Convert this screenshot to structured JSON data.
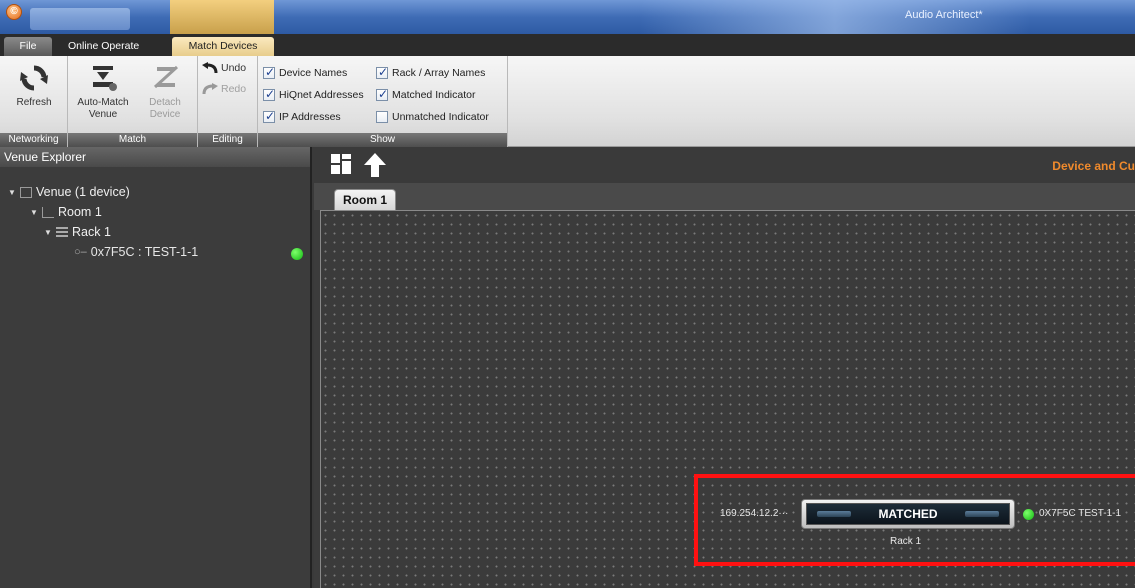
{
  "window": {
    "title": "Audio Architect*",
    "app_button_glyph": "©"
  },
  "tabs": [
    {
      "label": "File"
    },
    {
      "label": "Online Operate"
    },
    {
      "label": "Match Devices"
    }
  ],
  "ribbon": {
    "networking": {
      "label": "Networking",
      "refresh": "Refresh"
    },
    "match": {
      "label": "Match",
      "auto_match_line1": "Auto-Match",
      "auto_match_line2": "Venue",
      "detach_line1": "Detach",
      "detach_line2": "Device"
    },
    "editing": {
      "label": "Editing",
      "undo": "Undo",
      "redo": "Redo"
    },
    "show": {
      "label": "Show",
      "device_names": {
        "label": "Device Names",
        "checked": true
      },
      "hiqnet_addresses": {
        "label": "HiQnet Addresses",
        "checked": true
      },
      "ip_addresses": {
        "label": "IP Addresses",
        "checked": true
      },
      "rack_array_names": {
        "label": "Rack / Array Names",
        "checked": true
      },
      "matched_indicator": {
        "label": "Matched Indicator",
        "checked": true
      },
      "unmatched_indicator": {
        "label": "Unmatched Indicator",
        "checked": false
      }
    }
  },
  "venue_explorer": {
    "title": "Venue Explorer",
    "venue": "Venue (1 device)",
    "room": "Room 1",
    "rack": "Rack 1",
    "device": "0x7F5C : TEST-1-1"
  },
  "main": {
    "doc_title": "Device and Cu",
    "tab": "Room 1",
    "device": {
      "ip": "169.254.12.2···",
      "status": "MATCHED",
      "name": "0X7F5C  TEST-1-1",
      "rack": "Rack 1"
    }
  },
  "colors": {
    "accent": "#f08a2c",
    "matched_green": "#19c019",
    "highlight_red": "#ff1111"
  }
}
